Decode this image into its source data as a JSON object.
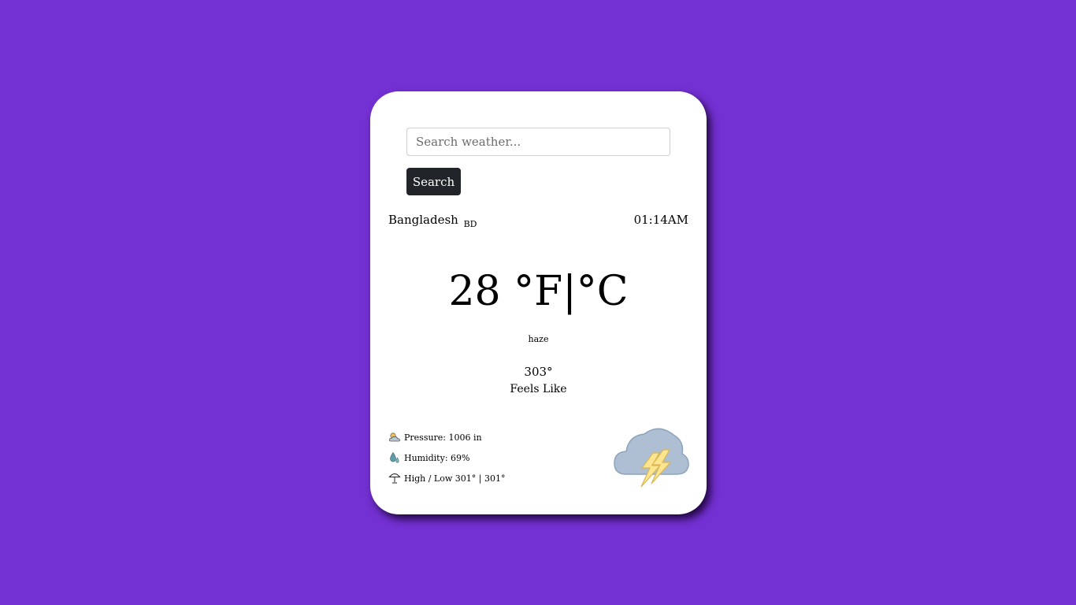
{
  "search": {
    "placeholder": "Search weather...",
    "button_label": "Search"
  },
  "location": {
    "city": "Bangladesh",
    "country": "BD"
  },
  "time": "01:14AM",
  "temperature": {
    "value": "28",
    "units": "°F|°C"
  },
  "condition": "haze",
  "feels_like": {
    "value": "303°",
    "label": "Feels Like"
  },
  "stats": {
    "pressure": "Pressure: 1006 in",
    "humidity": "Humidity: 69%",
    "high_low": "High / Low 301° | 301°"
  },
  "icons": {
    "pressure": "sun-cloud-icon",
    "humidity": "droplet-icon",
    "high_low": "umbrella-icon",
    "weather": "thunderstorm-cloud-icon"
  },
  "colors": {
    "background": "#7330d2",
    "card": "#ffffff",
    "button": "#212529",
    "cloud": "#aebfd3",
    "lightning": "#fde58f"
  }
}
